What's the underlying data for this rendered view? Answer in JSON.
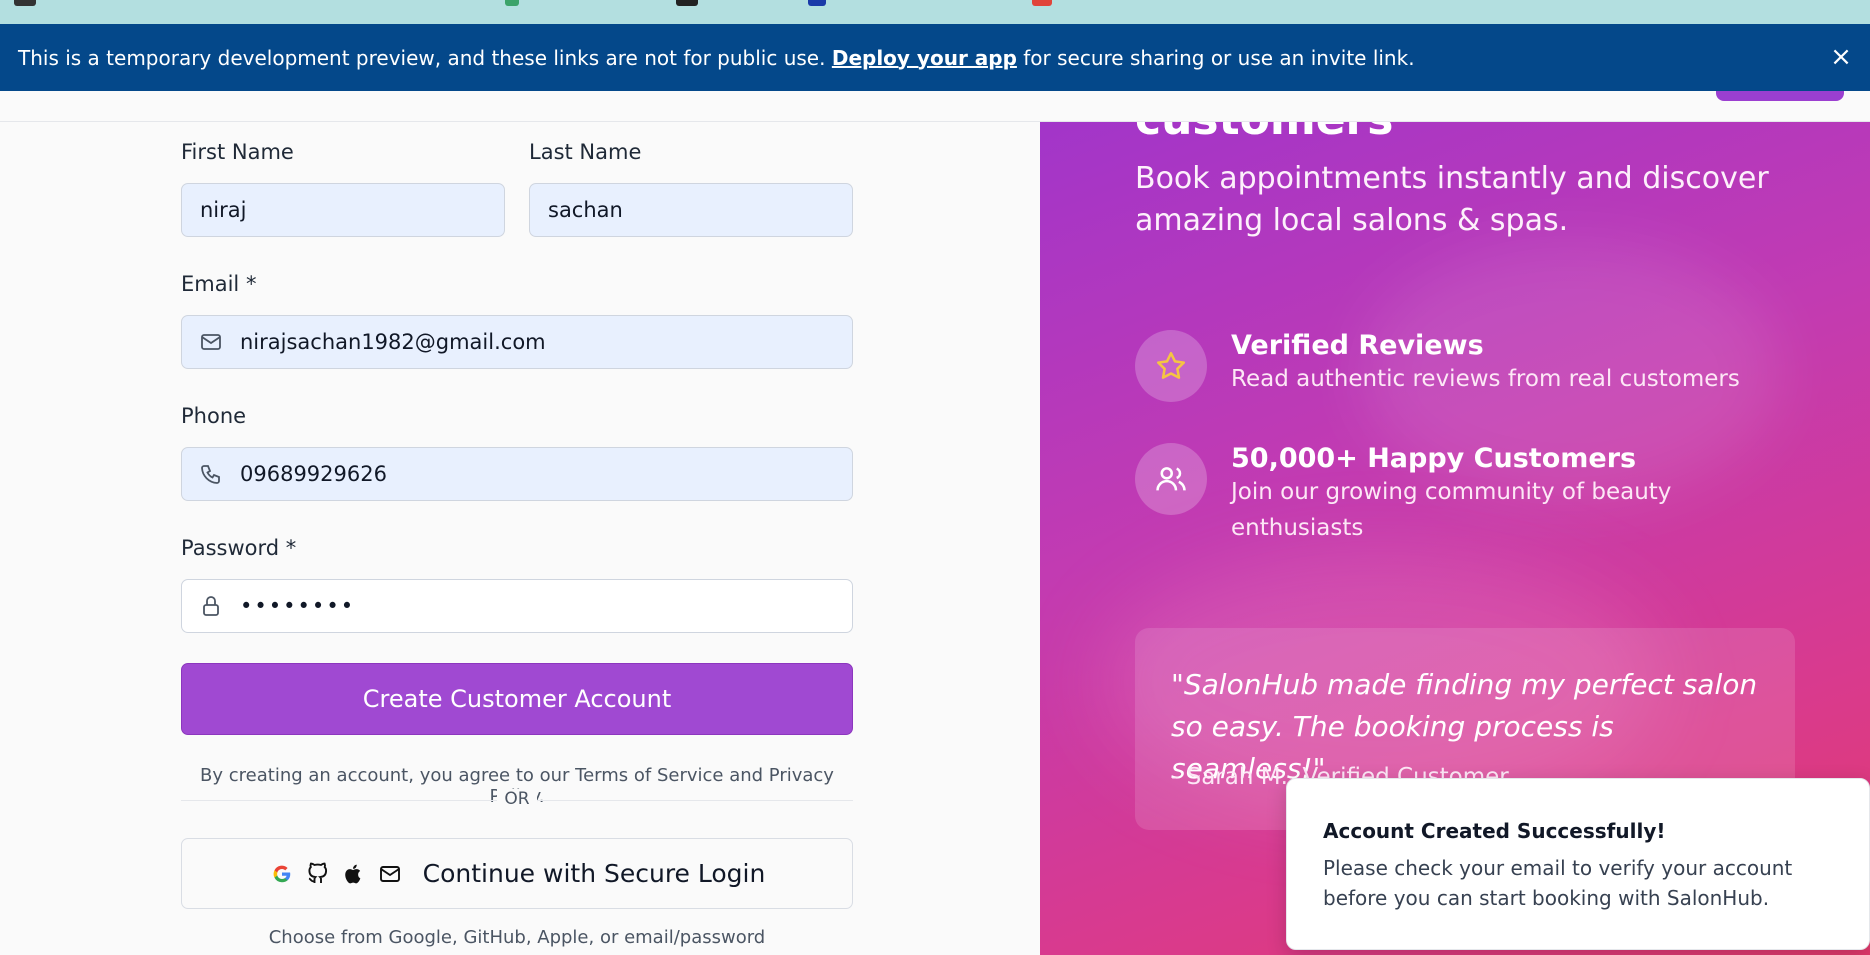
{
  "banner": {
    "text_before": "This is a temporary development preview, and these links are not for public use.",
    "link": "Deploy your app",
    "text_after": "for secure sharing or use an invite link.",
    "close_glyph": "×"
  },
  "form": {
    "first_name": {
      "label": "First Name",
      "value": "niraj"
    },
    "last_name": {
      "label": "Last Name",
      "value": "sachan"
    },
    "email": {
      "label": "Email *",
      "value": "nirajsachan1982@gmail.com",
      "icon": "mail-icon"
    },
    "phone": {
      "label": "Phone",
      "value": "09689929626",
      "icon": "phone-icon"
    },
    "password": {
      "label": "Password *",
      "value": "••••••••",
      "icon": "lock-icon"
    },
    "submit_label": "Create Customer Account",
    "terms_text": "By creating an account, you agree to our Terms of Service and Privacy Policy.",
    "or_text": "OR",
    "secure_login_label": "Continue with Secure Login",
    "choose_text": "Choose from Google, GitHub, Apple, or email/password"
  },
  "hero": {
    "heading_cut": "customers",
    "subtitle": "Book appointments instantly and discover amazing local salons & spas.",
    "features": [
      {
        "title": "Verified Reviews",
        "desc": "Read authentic reviews from real customers",
        "icon": "star-icon"
      },
      {
        "title": "50,000+ Happy Customers",
        "desc": "Join our growing community of beauty enthusiasts",
        "icon": "users-icon"
      }
    ],
    "quote": "\"SalonHub made finding my perfect salon so easy. The booking process is seamless!\"",
    "quote_author": "- Sarah M., Verified Customer"
  },
  "toast": {
    "title": "Account Created Successfully!",
    "desc": "Please check your email to verify your account before you can start booking with SalonHub."
  },
  "colors": {
    "banner_bg": "#04488a",
    "primary": "#a049d2",
    "hero_gradient_start": "#a235c9",
    "hero_gradient_end": "#e23a6c",
    "star": "#f5c542"
  }
}
